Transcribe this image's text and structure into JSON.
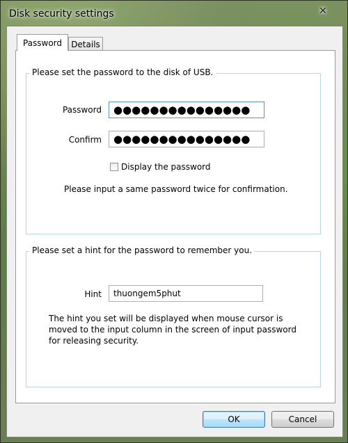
{
  "window": {
    "title": "Disk security settings",
    "close_glyph": "✕"
  },
  "tabs": [
    {
      "label": "Password",
      "selected": true
    },
    {
      "label": "Details",
      "selected": false
    }
  ],
  "password_group": {
    "title": "Please set the password to the disk of USB.",
    "password_label": "Password",
    "password_value": "●●●●●●●●●●●●●●●",
    "confirm_label": "Confirm",
    "confirm_value": "●●●●●●●●●●●●●●●",
    "display_checkbox_label": "Display the password",
    "display_checked": false,
    "instruction": "Please input a same password twice for confirmation."
  },
  "hint_group": {
    "title": "Please set a hint for the password to remember you.",
    "hint_label": "Hint",
    "hint_value": "thuongem5phut",
    "description": "The hint you set will be displayed when mouse cursor is\nmoved to the input column in the screen of input password\nfor releasing security."
  },
  "buttons": {
    "ok_label": "OK",
    "cancel_label": "Cancel"
  },
  "colors": {
    "group_border": "#b9d6e5",
    "focus_border": "#5c93bc",
    "default_button_border": "#3c7fb1"
  }
}
